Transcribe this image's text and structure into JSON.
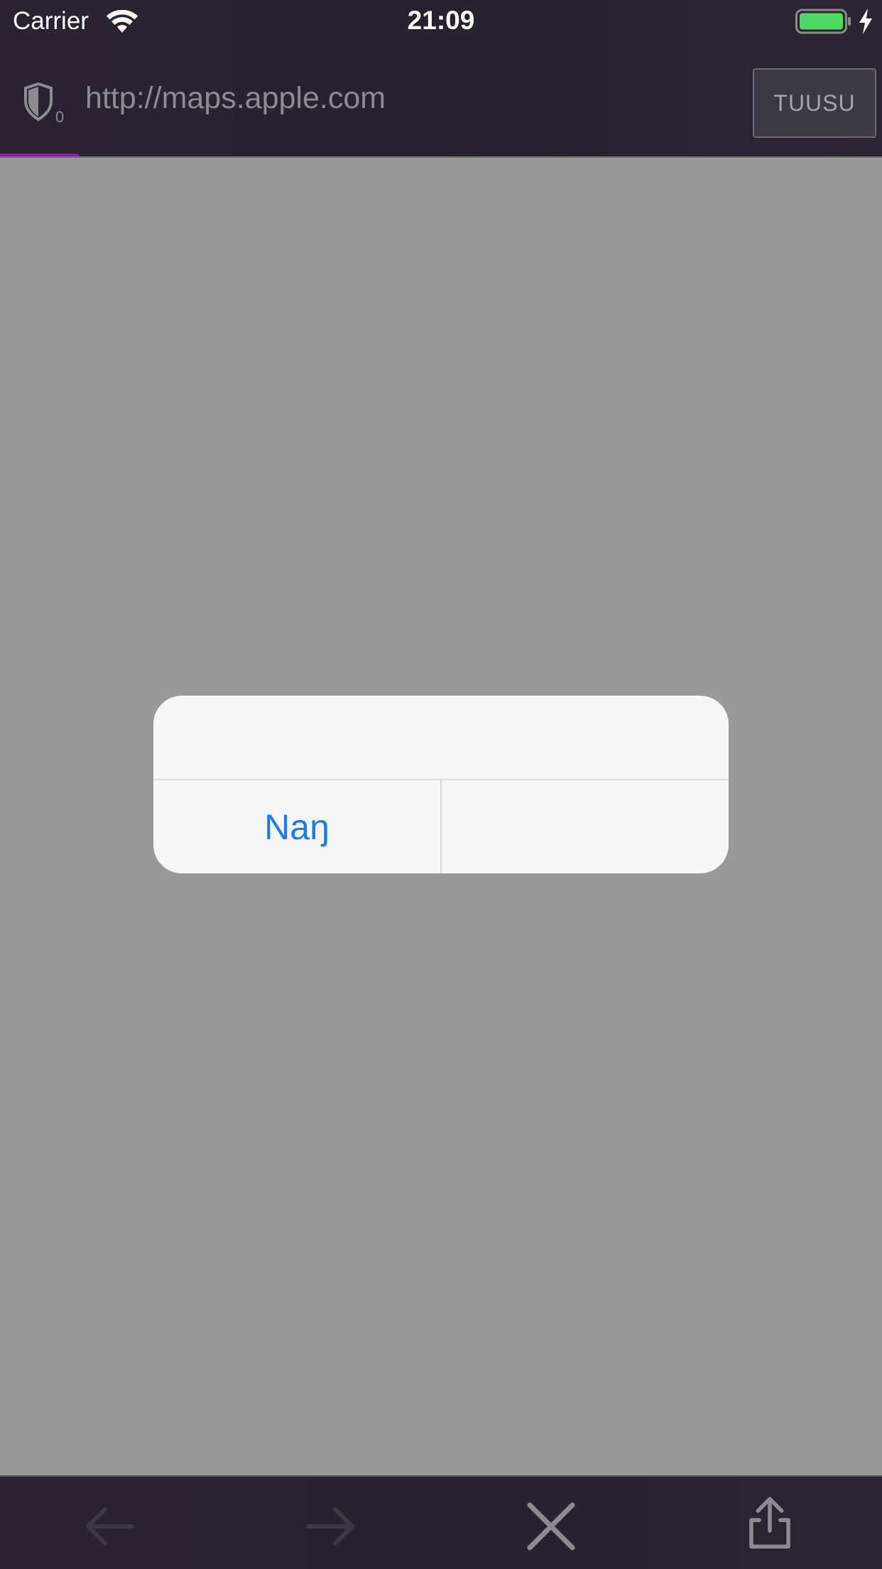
{
  "status_bar": {
    "carrier": "Carrier",
    "time": "21:09",
    "icons": [
      "wifi-icon",
      "battery-icon",
      "charging-icon"
    ],
    "battery_color": "#4cd964"
  },
  "url_bar": {
    "shield_icon": "shield-icon",
    "tracker_count": "0",
    "url": "http://maps.apple.com",
    "cancel_label": "TUUSU"
  },
  "progress": {
    "fraction": 0.09,
    "color": "#8e1aa6"
  },
  "alert": {
    "left_button_label": "Naŋ",
    "button_color": "#1a7cf0"
  },
  "toolbar": {
    "icons": [
      "back-arrow-icon",
      "forward-arrow-icon",
      "close-icon",
      "share-icon"
    ]
  },
  "colors": {
    "chrome_background": "#272230",
    "page_background": "#999999",
    "alert_background": "#f7f7f7"
  }
}
